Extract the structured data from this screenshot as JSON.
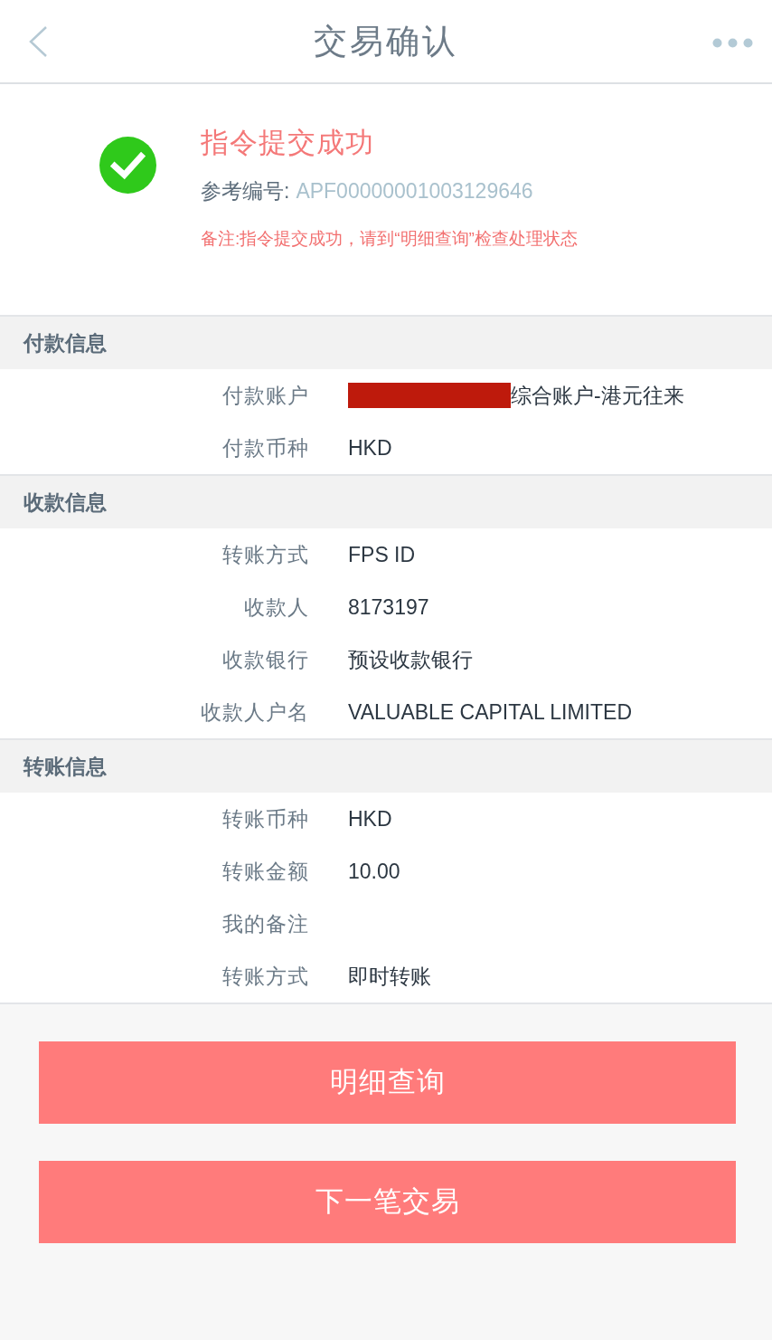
{
  "header": {
    "title": "交易确认"
  },
  "result": {
    "title": "指令提交成功",
    "reference": {
      "label": "参考编号:",
      "value": "APF00000001003129646"
    },
    "note": "备注:指令提交成功，请到“明细查询”检查处理状态"
  },
  "sections": [
    {
      "title": "付款信息",
      "rows": [
        {
          "label": "付款账户",
          "value": "综合账户-港元往来",
          "redacted": true
        },
        {
          "label": "付款币种",
          "value": "HKD",
          "redacted": false
        }
      ]
    },
    {
      "title": "收款信息",
      "rows": [
        {
          "label": "转账方式",
          "value": "FPS ID",
          "redacted": false
        },
        {
          "label": "收款人",
          "value": "8173197",
          "redacted": false
        },
        {
          "label": "收款银行",
          "value": "预设收款银行",
          "redacted": false
        },
        {
          "label": "收款人户名",
          "value": "VALUABLE CAPITAL LIMITED",
          "redacted": false
        }
      ]
    },
    {
      "title": "转账信息",
      "rows": [
        {
          "label": "转账币种",
          "value": "HKD",
          "redacted": false
        },
        {
          "label": "转账金额",
          "value": "10.00",
          "redacted": false
        },
        {
          "label": "我的备注",
          "redacted": false
        },
        {
          "label": "转账方式",
          "value": "即时转账",
          "redacted": false
        }
      ]
    }
  ],
  "buttons": [
    "明细查询",
    "下一笔交易"
  ]
}
